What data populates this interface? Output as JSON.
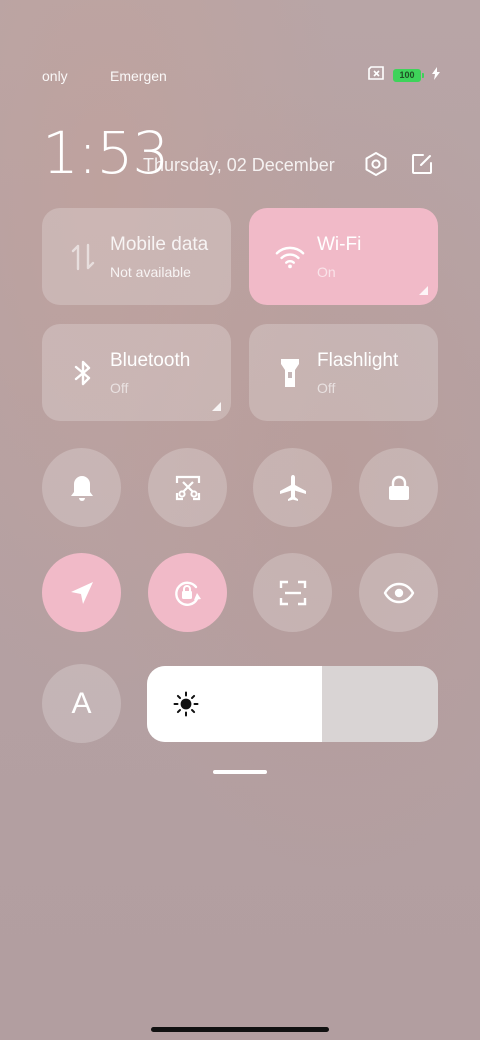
{
  "status_bar": {
    "carrier_1": "only",
    "carrier_2": "Emergency",
    "battery_level": "100",
    "icons": [
      "no-sim-icon",
      "battery-icon",
      "charging-icon"
    ]
  },
  "header": {
    "time": "1:53",
    "date": "Thursday, 02 December",
    "icons": [
      "settings-hexagon-icon",
      "edit-icon"
    ]
  },
  "tiles": [
    {
      "name": "Mobile data",
      "status": "Not available",
      "icon": "mobile-data-icon",
      "active": false
    },
    {
      "name": "Wi-Fi",
      "status": "On",
      "icon": "wifi-icon",
      "active": true
    },
    {
      "name": "Bluetooth",
      "status": "Off",
      "icon": "bluetooth-icon",
      "active": false
    },
    {
      "name": "Flashlight",
      "status": "Off",
      "icon": "flashlight-icon",
      "active": false
    }
  ],
  "toggles": [
    {
      "icon": "bell-icon",
      "active": false
    },
    {
      "icon": "screenshot-icon",
      "active": false
    },
    {
      "icon": "airplane-icon",
      "active": false
    },
    {
      "icon": "lock-icon",
      "active": false
    },
    {
      "icon": "location-icon",
      "active": true
    },
    {
      "icon": "rotation-lock-icon",
      "active": true
    },
    {
      "icon": "scan-icon",
      "active": false
    },
    {
      "icon": "eye-icon",
      "active": false
    },
    {
      "icon": "font-size-icon",
      "active": false
    }
  ],
  "toggle_glyphs": {
    "font": "A"
  },
  "brightness": {
    "level": 0.6,
    "icon": "sun-icon"
  },
  "colors": {
    "accent": "#f1bac8",
    "battery": "#3ed35a"
  }
}
